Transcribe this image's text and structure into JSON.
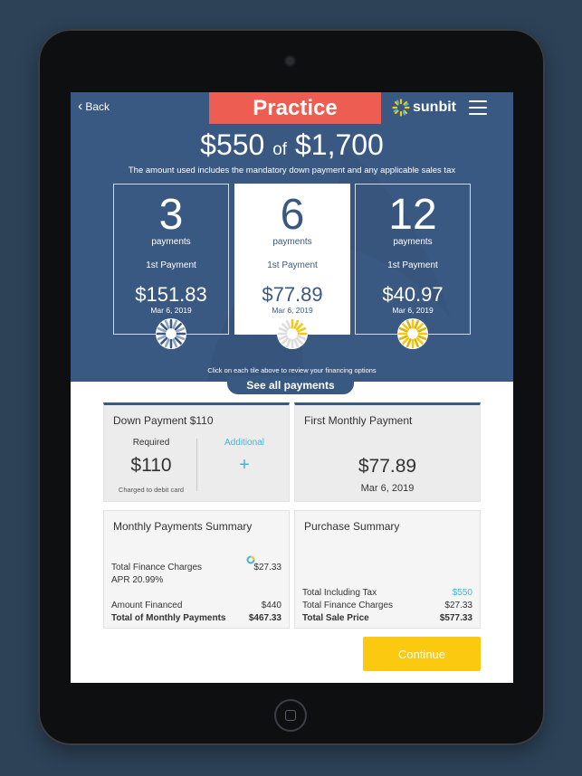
{
  "header": {
    "back_label": "Back",
    "mode_label": "Practice",
    "brand_name": "sunbit"
  },
  "summary": {
    "used_amount": "$550",
    "of_label": "of",
    "total_amount": "$1,700",
    "note": "The amount used includes the mandatory down payment and any applicable sales tax"
  },
  "plans": [
    {
      "count": "3",
      "unit": "payments",
      "first_label": "1st Payment",
      "price": "$151.83",
      "date": "Mar 6, 2019"
    },
    {
      "count": "6",
      "unit": "payments",
      "first_label": "1st Payment",
      "price": "$77.89",
      "date": "Mar 6, 2019"
    },
    {
      "count": "12",
      "unit": "payments",
      "first_label": "1st Payment",
      "price": "$40.97",
      "date": "Mar 6, 2019"
    }
  ],
  "selected_plan_index": 1,
  "plan_hint": "Click on each tile above to review your financing options",
  "see_all_label": "See all payments",
  "down_payment": {
    "title": "Down Payment $110",
    "required_label": "Required",
    "required_value": "$110",
    "required_note": "Charged to debit card",
    "additional_label": "Additional",
    "additional_icon": "plus-icon"
  },
  "first_monthly": {
    "title": "First Monthly Payment",
    "amount": "$77.89",
    "date": "Mar 6, 2019"
  },
  "monthly_summary": {
    "title": "Monthly Payments Summary",
    "finance_label": "Total Finance Charges",
    "finance_value": "$27.33",
    "apr": "APR 20.99%",
    "financed_label": "Amount Financed",
    "financed_value": "$440",
    "total_label": "Total of Monthly Payments",
    "total_value": "$467.33"
  },
  "purchase_summary": {
    "title": "Purchase Summary",
    "tax_label": "Total Including Tax",
    "tax_value": "$550",
    "finance_label": "Total Finance Charges",
    "finance_value": "$27.33",
    "sale_label": "Total Sale Price",
    "sale_value": "$577.33"
  },
  "continue_label": "Continue",
  "colors": {
    "header_bg": "#3a5982",
    "practice_bg": "#ee5d52",
    "accent_blue": "#3fb6dc",
    "continue_bg": "#fbc90f"
  }
}
